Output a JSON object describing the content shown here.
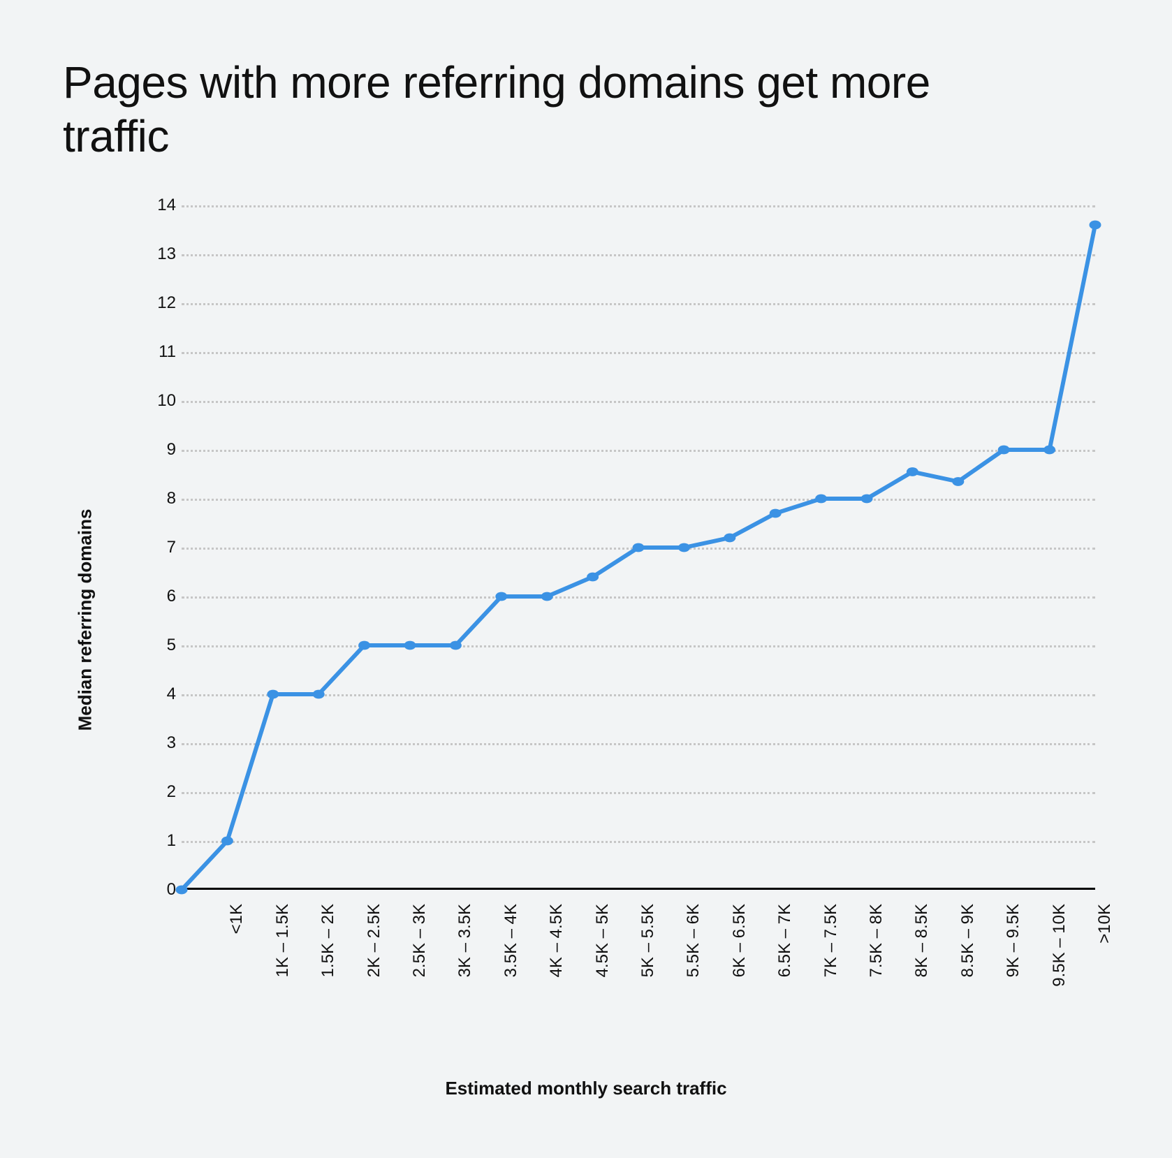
{
  "title": "Pages with more referring domains get more traffic",
  "chart_data": {
    "type": "line",
    "title": "Pages with more referring domains get more traffic",
    "xlabel": "Estimated monthly search traffic",
    "ylabel": "Median referring domains",
    "ylim": [
      0,
      14
    ],
    "y_ticks": [
      0,
      1,
      2,
      3,
      4,
      5,
      6,
      7,
      8,
      9,
      10,
      11,
      12,
      13,
      14
    ],
    "categories": [
      "<1K",
      "1K – 1.5K",
      "1.5K – 2K",
      "2K – 2.5K",
      "2.5K – 3K",
      "3K – 3.5K",
      "3.5K – 4K",
      "4K – 4.5K",
      "4.5K – 5K",
      "5K – 5.5K",
      "5.5K – 6K",
      "6K – 6.5K",
      "6.5K – 7K",
      "7K – 7.5K",
      "7.5K – 8K",
      "8K – 8.5K",
      "8.5K – 9K",
      "9K – 9.5K",
      "9.5K – 10K",
      ">10K"
    ],
    "values": [
      0,
      1,
      4,
      4,
      5,
      5,
      5,
      6,
      6,
      6.4,
      7,
      7,
      7.2,
      7.7,
      8,
      8,
      8.55,
      8.35,
      9,
      9,
      13.6
    ],
    "line_color": "#3b92e4"
  }
}
